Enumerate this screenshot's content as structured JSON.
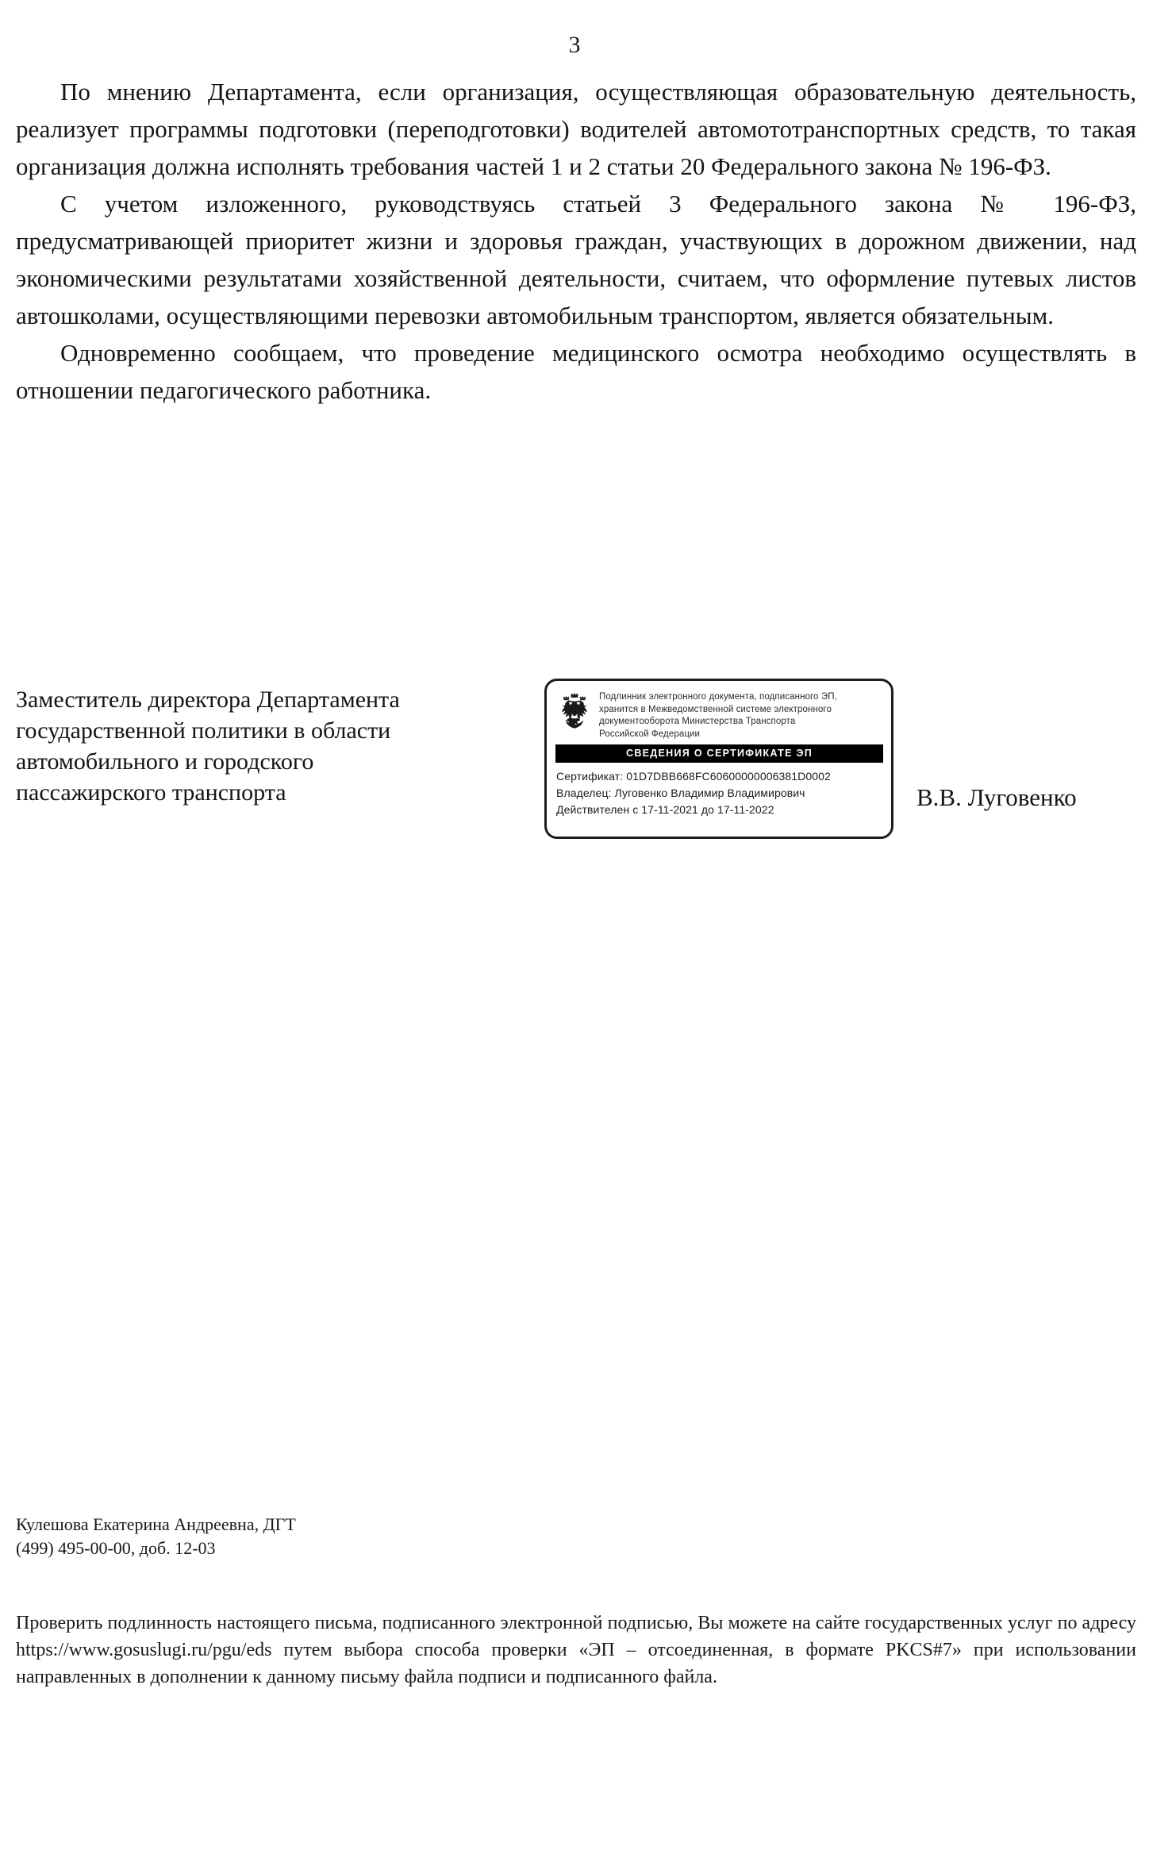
{
  "document": {
    "page_number": "3",
    "paragraphs": [
      "По мнению Департамента, если организация, осуществляющая образовательную деятельность, реализует программы подготовки (переподготовки) водителей автомототранспортных средств, то такая организация должна исполнять требования частей 1 и 2 статьи 20 Федерального закона № 196-ФЗ.",
      "С учетом изложенного, руководствуясь статьей 3 Федерального закона № 196-ФЗ, предусматривающей приоритет жизни и здоровья граждан, участвующих в дорожном движении, над экономическими результатами хозяйственной деятельности, считаем, что оформление путевых листов автошколами, осуществляющими перевозки автомобильным транспортом, является обязательным.",
      "Одновременно сообщаем, что проведение медицинского осмотра необходимо осуществлять в отношении педагогического работника."
    ]
  },
  "signature": {
    "title_lines": [
      "Заместитель директора Департамента",
      "государственной политики в области",
      "автомобильного и городского",
      "пассажирского транспорта"
    ],
    "signer_name": "В.В. Луговенко"
  },
  "stamp": {
    "emblem_name": "russian-coat-of-arms-icon",
    "header_lines": [
      "Подлинник электронного документа, подписанного ЭП,",
      "хранится в Межведомственной системе электронного",
      "документооборота  Министерства Транспорта",
      "Российской Федерации"
    ],
    "bar_label": "СВЕДЕНИЯ О СЕРТИФИКАТЕ ЭП",
    "certificate_line": "Сертификат: 01D7DBB668FC60600000006381D0002",
    "owner_line": "Владелец: Луговенко Владимир Владимирович",
    "validity_line": "Действителен с 17-11-2021 до 17-11-2022"
  },
  "executor": {
    "name_line": "Кулешова Екатерина Андреевна, ДГТ",
    "phone_line": "(499) 495-00-00, доб. 12-03"
  },
  "verification": {
    "text": "Проверить подлинность настоящего письма, подписанного электронной подписью, Вы можете на сайте государственных услуг по адресу https://www.gosuslugi.ru/pgu/eds путем выбора способа проверки «ЭП – отсоединенная, в формате PKCS#7» при использовании направленных в дополнении к данному письму файла подписи и подписанного файла."
  },
  "colors": {
    "ink": "#141414",
    "stamp_border": "#1c1c1c",
    "stamp_bar_bg": "#000000",
    "stamp_bar_fg": "#ffffff",
    "page_bg": "#ffffff"
  }
}
